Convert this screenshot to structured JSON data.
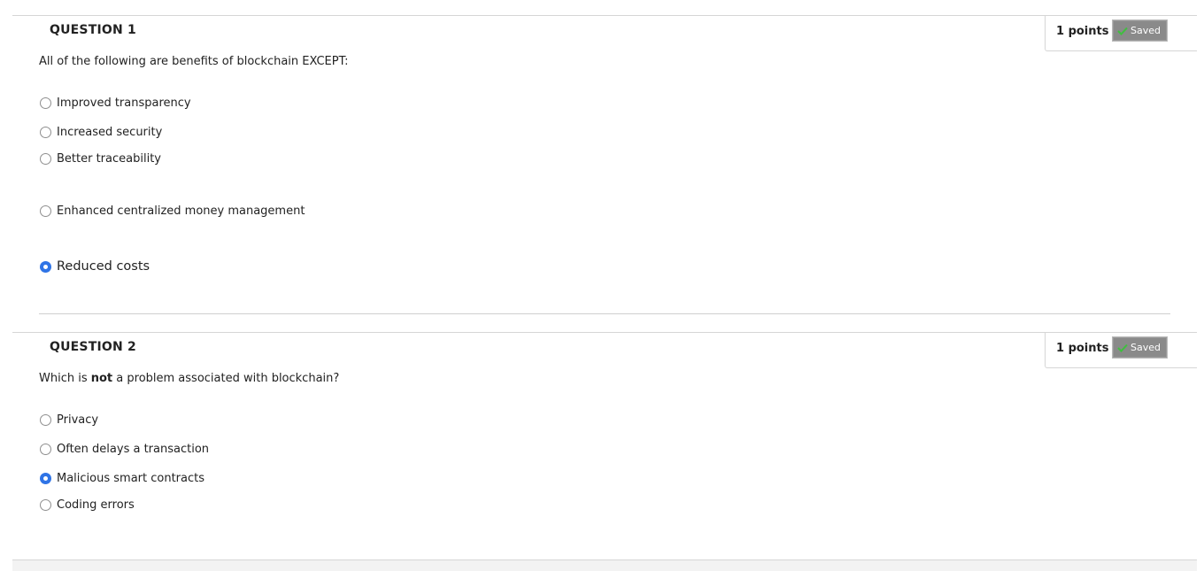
{
  "questions": [
    {
      "title": "QUESTION 1",
      "points": "1 points",
      "status": "Saved",
      "text": "All of the following are benefits of blockchain EXCEPT:",
      "options": [
        {
          "label": "Improved transparency",
          "selected": false
        },
        {
          "label": "Increased security",
          "selected": false
        },
        {
          "label": "Better traceability",
          "selected": false
        },
        {
          "label": "Enhanced centralized money management",
          "selected": false
        },
        {
          "label": "Reduced costs",
          "selected": true
        }
      ]
    },
    {
      "title": "QUESTION 2",
      "points": "1 points",
      "status": "Saved",
      "text_before": "Which is ",
      "text_bold": "not",
      "text_after": " a problem associated with blockchain?",
      "options": [
        {
          "label": "Privacy",
          "selected": false
        },
        {
          "label": "Often delays a transaction",
          "selected": false
        },
        {
          "label": "Malicious smart contracts",
          "selected": true
        },
        {
          "label": "Coding errors",
          "selected": false
        }
      ]
    }
  ],
  "colors": {
    "radio_selected": "#2f74e6",
    "saved_badge_bg": "#8a8a8a",
    "check_icon": "#3fbf3f"
  },
  "icons": {
    "saved": "check-icon"
  }
}
